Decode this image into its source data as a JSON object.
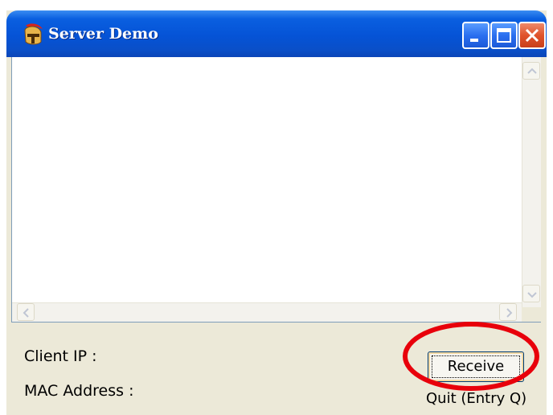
{
  "window": {
    "title": "Server Demo",
    "icon": "spartan-helmet-icon",
    "controls": [
      "minimize-icon",
      "maximize-icon",
      "close-icon"
    ]
  },
  "output": {
    "text": ""
  },
  "form": {
    "client_ip_label": "Client IP :",
    "mac_address_label": "MAC Address :",
    "receive_button": "Receive",
    "quit_hint": "Quit (Entry Q)"
  },
  "colors": {
    "titlebar": "#0553d6",
    "close_button": "#e0532c",
    "window_body": "#ece9d8",
    "highlight_ellipse": "#e8000b"
  }
}
